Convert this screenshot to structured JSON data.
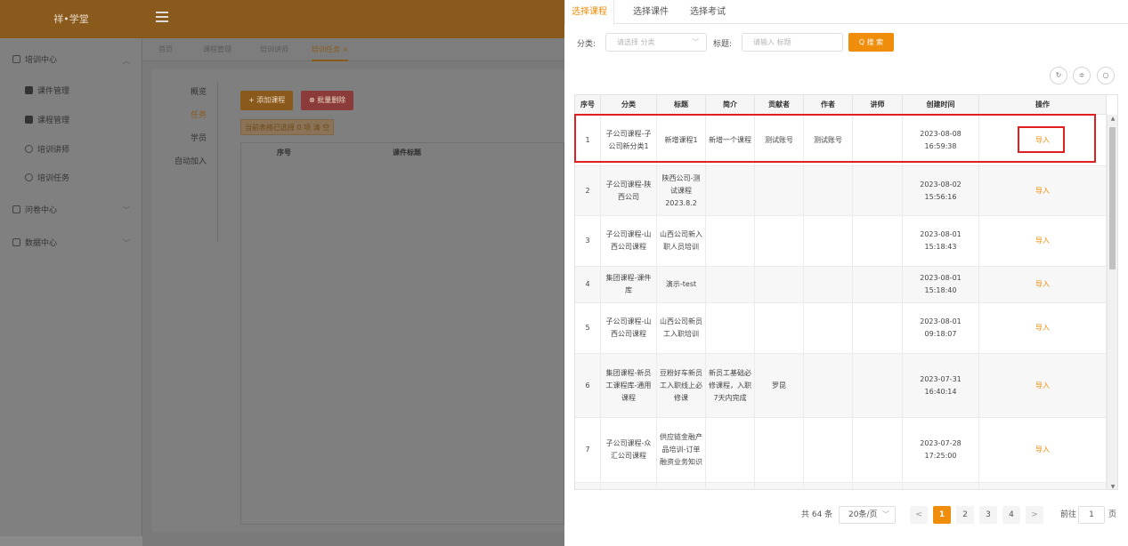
{
  "app": {
    "logo": "祥•学堂"
  },
  "bg_sidebar": {
    "items": [
      {
        "label": "培训中心"
      },
      {
        "label": "课件管理"
      },
      {
        "label": "课程管理"
      },
      {
        "label": "培训讲师"
      },
      {
        "label": "培训任务"
      },
      {
        "label": "问卷中心"
      },
      {
        "label": "数据中心"
      }
    ]
  },
  "bg_tabs": [
    {
      "label": "首页"
    },
    {
      "label": "课程管理"
    },
    {
      "label": "培训讲师"
    },
    {
      "label": "培训任务 ×"
    }
  ],
  "bg_main": {
    "vtabs": [
      "概览",
      "任务",
      "学员",
      "自动加入"
    ],
    "add_button": "+ 添加课程",
    "delete_button": "⊗ 批量删除",
    "selected_info": "当前表格已选择 0 项  清 空",
    "table_headers": [
      "序号",
      "课件标题"
    ]
  },
  "drawer": {
    "tabs": [
      {
        "label": "选择课程",
        "active": true
      },
      {
        "label": "选择课件",
        "active": false
      },
      {
        "label": "选择考试",
        "active": false
      }
    ],
    "filter": {
      "category_label": "分类:",
      "category_placeholder": "请选择 分类",
      "title_label": "标题:",
      "title_placeholder": "请输入 标题",
      "search_button": "Q 搜 索"
    },
    "table": {
      "headers": [
        "序号",
        "分类",
        "标题",
        "简介",
        "贡献者",
        "作者",
        "讲师",
        "创建时间",
        "操作"
      ],
      "rows": [
        {
          "no": "1",
          "category": "子公司课程-子公司新分类1",
          "title": "新增课程1",
          "intro": "新增一个课程",
          "contributor": "测试账号",
          "author": "测试账号",
          "lecturer": "",
          "created": "2023-08-08 16:59:38",
          "action": "导入"
        },
        {
          "no": "2",
          "category": "子公司课程-陕西公司",
          "title": "陕西公司-测试课程2023.8.2",
          "intro": "",
          "contributor": "",
          "author": "",
          "lecturer": "",
          "created": "2023-08-02 15:56:16",
          "action": "导入"
        },
        {
          "no": "3",
          "category": "子公司课程-山西公司课程",
          "title": "山西公司新入职人员培训",
          "intro": "",
          "contributor": "",
          "author": "",
          "lecturer": "",
          "created": "2023-08-01 15:18:43",
          "action": "导入"
        },
        {
          "no": "4",
          "category": "集团课程-课件库",
          "title": "演示-test",
          "intro": "",
          "contributor": "",
          "author": "",
          "lecturer": "",
          "created": "2023-08-01 15:18:40",
          "action": "导入"
        },
        {
          "no": "5",
          "category": "子公司课程-山西公司课程",
          "title": "山西公司新员工入职培训",
          "intro": "",
          "contributor": "",
          "author": "",
          "lecturer": "",
          "created": "2023-08-01 09:18:07",
          "action": "导入"
        },
        {
          "no": "6",
          "category": "集团课程-新员工课程库-通用课程",
          "title": "豆粉好车新员工入职线上必修课",
          "intro": "新员工基础必修课程，入职7天内完成",
          "contributor": "罗昆",
          "author": "",
          "lecturer": "",
          "created": "2023-07-31 16:40:14",
          "action": "导入"
        },
        {
          "no": "7",
          "category": "子公司课程-众汇公司课程",
          "title": "供应链金融产品培训-订单融资业务知识",
          "intro": "",
          "contributor": "",
          "author": "",
          "lecturer": "",
          "created": "2023-07-28 17:25:00",
          "action": "导入"
        }
      ]
    },
    "pagination": {
      "total": "共 64 条",
      "page_size": "20条/页",
      "pages": [
        "1",
        "2",
        "3",
        "4"
      ],
      "current": "1",
      "prev": "<",
      "next": ">",
      "goto_label": "前往",
      "goto_value": "1",
      "goto_suffix": "页"
    }
  },
  "colors": {
    "accent": "#f08d0b",
    "highlight": "#e02020"
  }
}
